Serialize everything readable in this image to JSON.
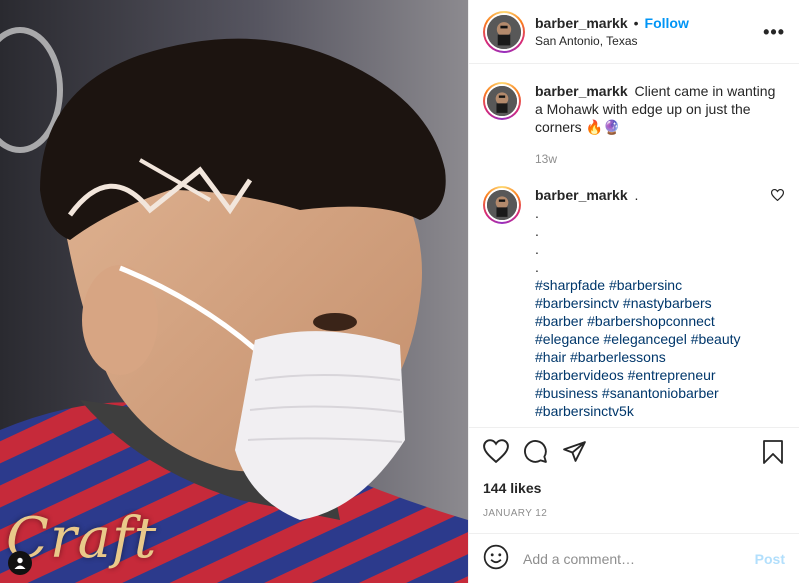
{
  "colors": {
    "link_blue": "#0095f6",
    "hashtag": "#00376b",
    "muted": "#8e8e8e",
    "post_disabled": "#b2dffc"
  },
  "photo": {
    "watermark": "Craft",
    "tag_icon": "user-tag-icon"
  },
  "header": {
    "username": "barber_markk",
    "separator": "•",
    "follow_label": "Follow",
    "location": "San Antonio, Texas",
    "more_label": "•••"
  },
  "caption": {
    "username": "barber_markk",
    "text": "Client came in wanting a Mohawk with edge up on just the corners 🔥🔮",
    "time": "13w"
  },
  "comment": {
    "username": "barber_markk",
    "text": ".",
    "dots": [
      ".",
      ".",
      ".",
      "."
    ],
    "hashtag_lines": [
      "#sharpfade #barbersinc",
      "#barbersinctv #nastybarbers",
      "#barber #barbershopconnect",
      "#elegance #elegancegel #beauty",
      "#hair #barberlessons",
      "#barbervideos #entrepreneur",
      "#business #sanantoniobarber",
      "#barbersinctv5k"
    ]
  },
  "actions": {
    "icons": [
      "heart-icon",
      "comment-icon",
      "share-icon",
      "bookmark-icon"
    ],
    "likes": "144 likes",
    "date": "JANUARY 12"
  },
  "add_comment": {
    "placeholder": "Add a comment…",
    "post_label": "Post",
    "emoji_icon": "emoji-icon"
  }
}
